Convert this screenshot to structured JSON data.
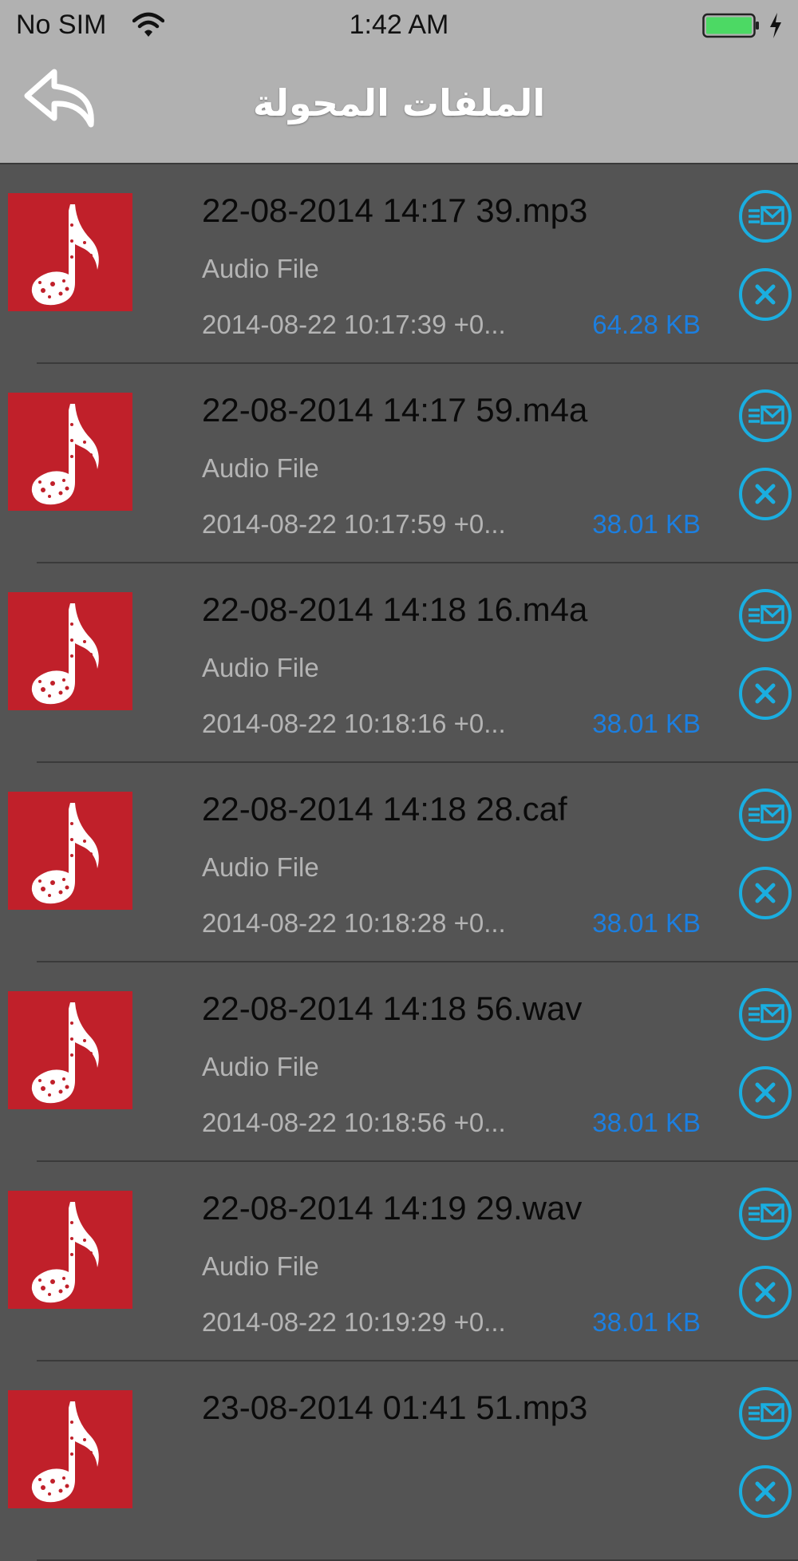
{
  "status_bar": {
    "carrier": "No SIM",
    "time": "1:42 AM",
    "wifi_icon": "wifi-icon",
    "battery_icon": "battery-charging-icon"
  },
  "nav_bar": {
    "title": "الملفات المحولة",
    "back_icon": "back-arrow-icon"
  },
  "colors": {
    "bar_background": "#b1b1b1",
    "list_background": "#545454",
    "thumbnail_red": "#c0202a",
    "accent_cyan": "#1aaee0",
    "size_blue": "#1c7fe0"
  },
  "files": [
    {
      "name": "22-08-2014 14:17 39.mp3",
      "type": "Audio File",
      "date": "2014-08-22 10:17:39 +0...",
      "size": "64.28 KB"
    },
    {
      "name": "22-08-2014 14:17 59.m4a",
      "type": "Audio File",
      "date": "2014-08-22 10:17:59 +0...",
      "size": "38.01 KB"
    },
    {
      "name": "22-08-2014 14:18 16.m4a",
      "type": "Audio File",
      "date": "2014-08-22 10:18:16 +0...",
      "size": "38.01 KB"
    },
    {
      "name": "22-08-2014 14:18 28.caf",
      "type": "Audio File",
      "date": "2014-08-22 10:18:28 +0...",
      "size": "38.01 KB"
    },
    {
      "name": "22-08-2014 14:18 56.wav",
      "type": "Audio File",
      "date": "2014-08-22 10:18:56 +0...",
      "size": "38.01 KB"
    },
    {
      "name": "22-08-2014 14:19 29.wav",
      "type": "Audio File",
      "date": "2014-08-22 10:19:29 +0...",
      "size": "38.01 KB"
    },
    {
      "name": "23-08-2014 01:41 51.mp3",
      "type": "",
      "date": "",
      "size": ""
    }
  ]
}
